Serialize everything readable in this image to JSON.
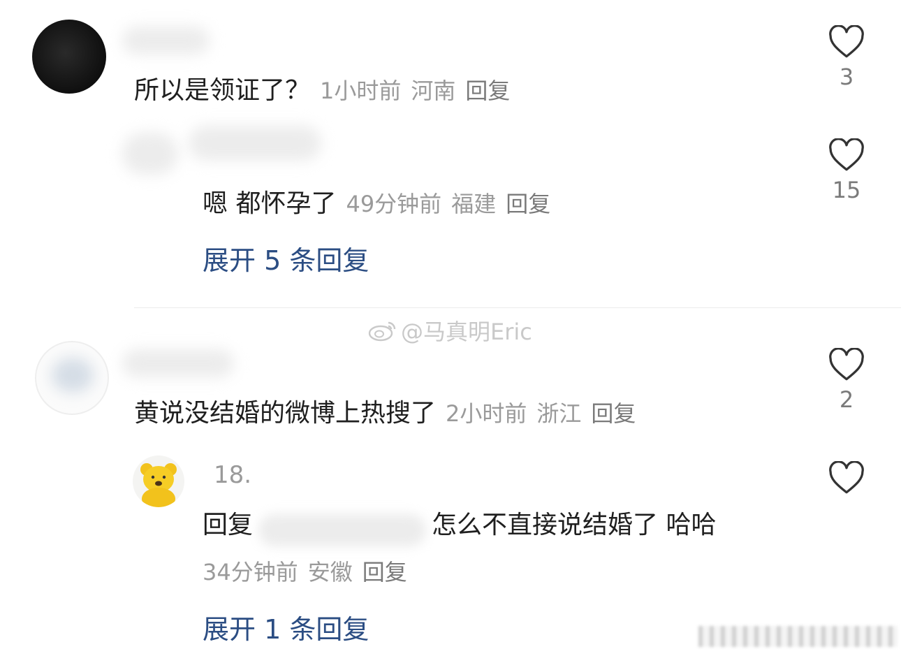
{
  "comments": [
    {
      "text": "所以是领证了？",
      "time": "1小时前",
      "location": "河南",
      "reply_label": "回复",
      "likes": "3",
      "replies": [
        {
          "text": "嗯 都怀孕了",
          "time": "49分钟前",
          "location": "福建",
          "reply_label": "回复",
          "likes": "15"
        }
      ],
      "expand_label": "展开 5 条回复"
    },
    {
      "text": "黄说没结婚的微博上热搜了",
      "time": "2小时前",
      "location": "浙江",
      "reply_label": "回复",
      "likes": "2",
      "replies": [
        {
          "username": "18.",
          "reply_prefix": "回复",
          "text": "怎么不直接说结婚了 哈哈",
          "time": "34分钟前",
          "location": "安徽",
          "reply_label": "回复",
          "likes": ""
        }
      ],
      "expand_label": "展开 1 条回复"
    }
  ],
  "watermark": "@马真明Eric",
  "icons": {
    "like": "heart-outline-icon",
    "watermark_logo": "weibo-logo-icon"
  },
  "colors": {
    "text": "#1f1f1f",
    "meta": "#9a9a9a",
    "link": "#2b4d83",
    "icon": "#333333"
  }
}
